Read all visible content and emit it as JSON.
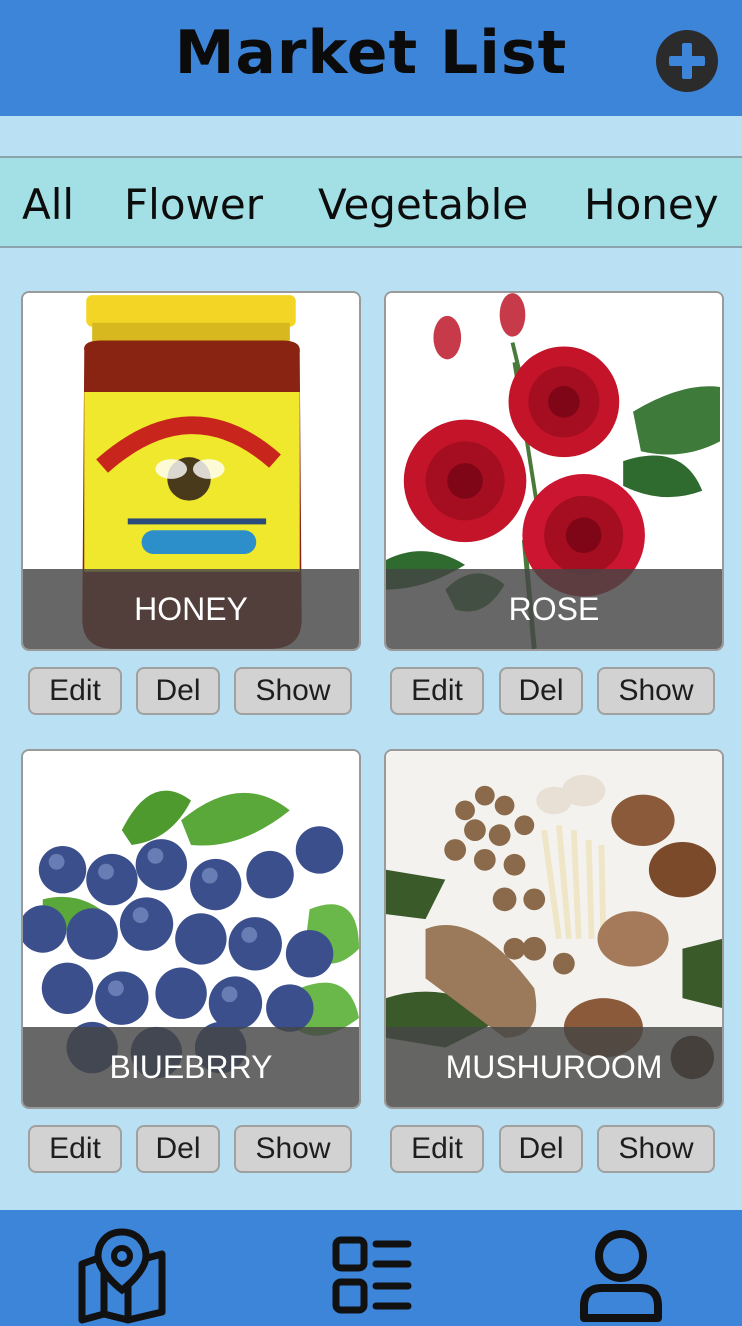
{
  "header": {
    "title": "Market List",
    "add_icon": "plus-circle-icon"
  },
  "tabs": [
    {
      "label": "All"
    },
    {
      "label": "Flower"
    },
    {
      "label": "Vegetable"
    },
    {
      "label": "Honey"
    }
  ],
  "products": [
    {
      "name": "HONEY",
      "image": "honey-jar-image"
    },
    {
      "name": "ROSE",
      "image": "rose-flowers-image"
    },
    {
      "name": "BIUEBRRY",
      "image": "blueberries-image"
    },
    {
      "name": "MUSHUROOM",
      "image": "mushrooms-image"
    }
  ],
  "actions": {
    "edit": "Edit",
    "delete": "Del",
    "show": "Show"
  },
  "bottom_nav": [
    {
      "icon": "map-pin-icon"
    },
    {
      "icon": "list-icon"
    },
    {
      "icon": "user-icon"
    }
  ],
  "colors": {
    "header": "#3d85d9",
    "background": "#b9e1f3",
    "tabs_bar": "#a3e0e6",
    "button": "#d2d2d2"
  }
}
